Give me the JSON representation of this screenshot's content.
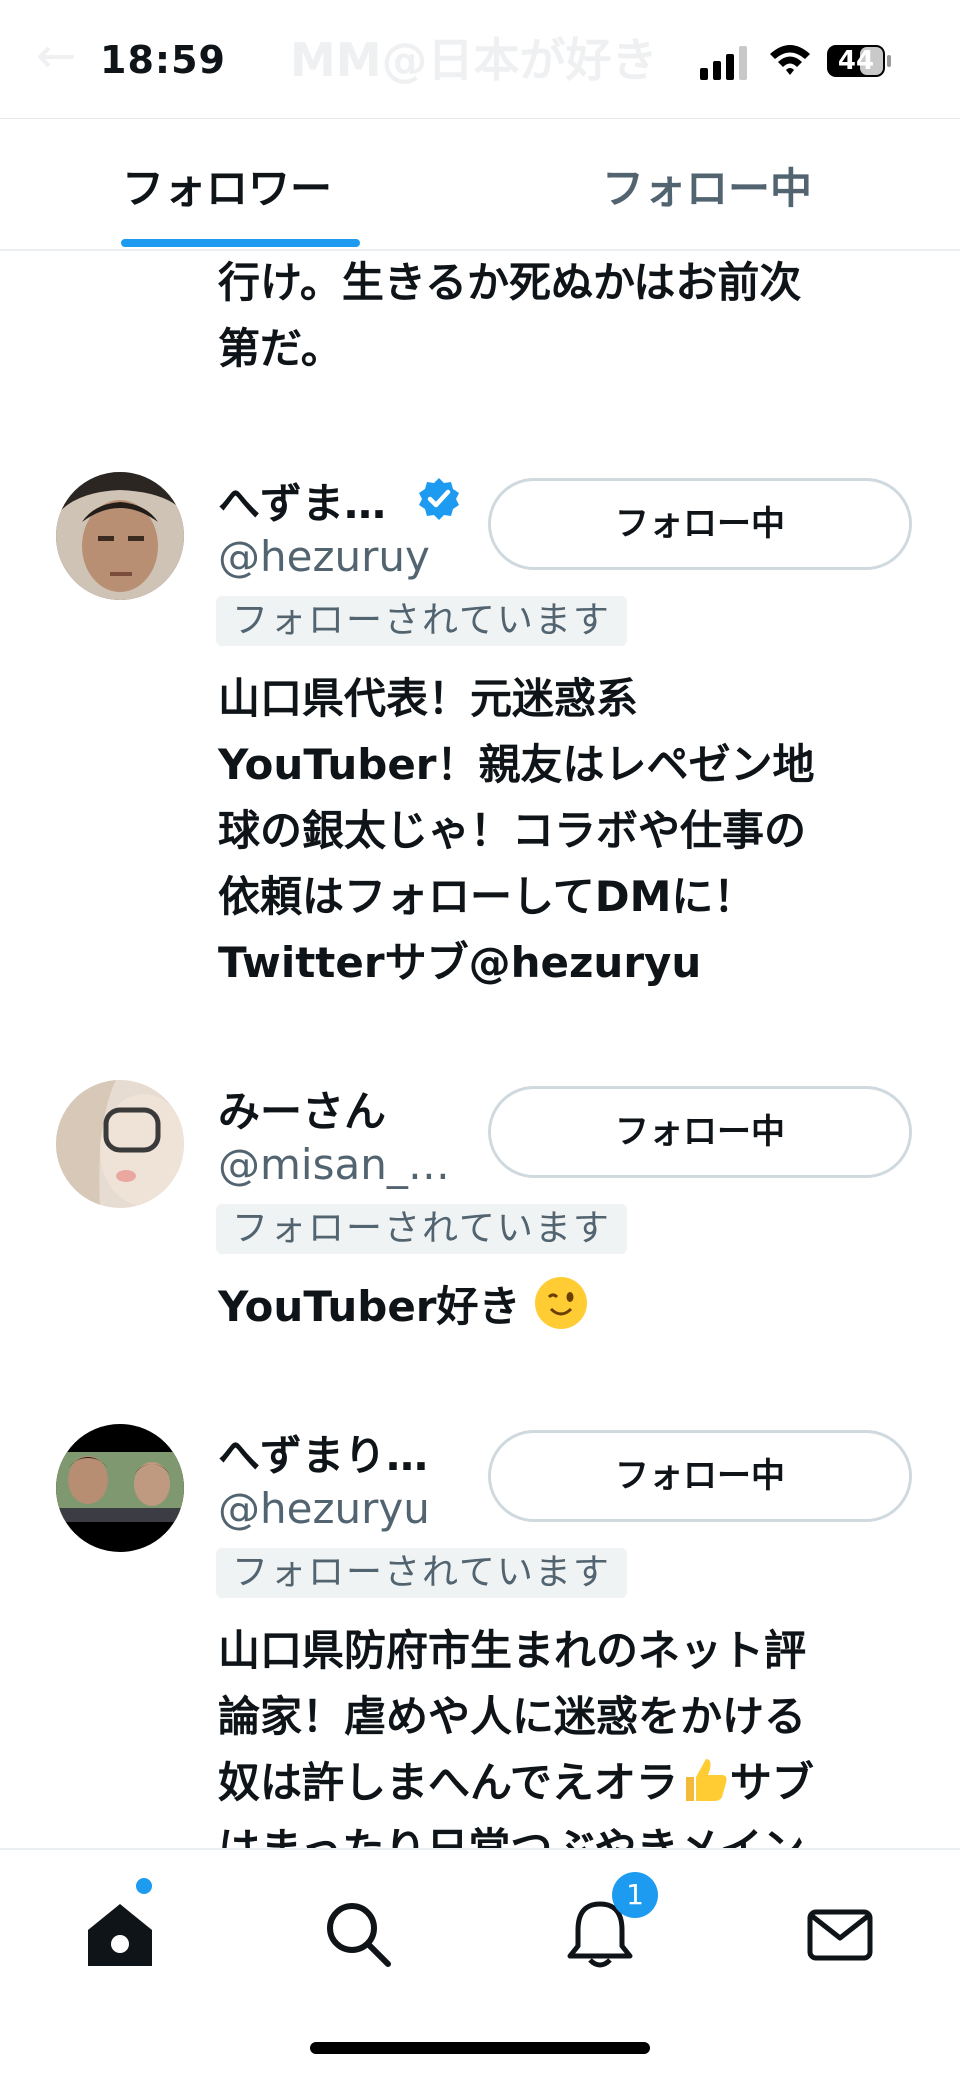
{
  "status_bar": {
    "time": "18:59",
    "battery": "44",
    "ghost_title": "MM@日本が好き"
  },
  "tabs": [
    {
      "label": "フォロワー",
      "active": true
    },
    {
      "label": "フォロー中",
      "active": false
    }
  ],
  "feed": {
    "prev_bio_tail": [
      "行け。生きるか死ぬかはお前次",
      "第だ。"
    ],
    "users": [
      {
        "name": "へずま…",
        "verified": true,
        "handle": "@hezuruy",
        "follows_you": "フォローされています",
        "button": "フォロー中",
        "bio": [
          "山口県代表！元迷惑系",
          "YouTuber！親友はレペゼン地",
          "球の銀太じゃ！コラボや仕事の",
          "依頼はフォローしてDMに！",
          "Twitterサブ@hezuryu"
        ]
      },
      {
        "name": "みーさん",
        "verified": false,
        "handle": "@misan_…",
        "follows_you": "フォローされています",
        "button": "フォロー中",
        "bio": [
          "YouTuber好き"
        ],
        "bio_emoji": "winking-face"
      },
      {
        "name": "へずまり…",
        "verified": false,
        "handle": "@hezuryu",
        "follows_you": "フォローされています",
        "button": "フォロー中",
        "bio": [
          "山口県防府市生まれのネット評",
          "論家！虐めや人に迷惑をかける",
          "奴は許しまへんでえオラ",
          "はまったり日常つぶやきメイン"
        ],
        "bio_emoji": "thumbs-up",
        "bio_line3_suffix": "サブ"
      }
    ]
  },
  "bottom_nav": {
    "items": [
      "home-icon",
      "search-icon",
      "notifications-icon",
      "messages-icon"
    ],
    "notification_count": "1"
  },
  "colors": {
    "accent": "#1d9bf0",
    "secondary_text": "#536471"
  }
}
